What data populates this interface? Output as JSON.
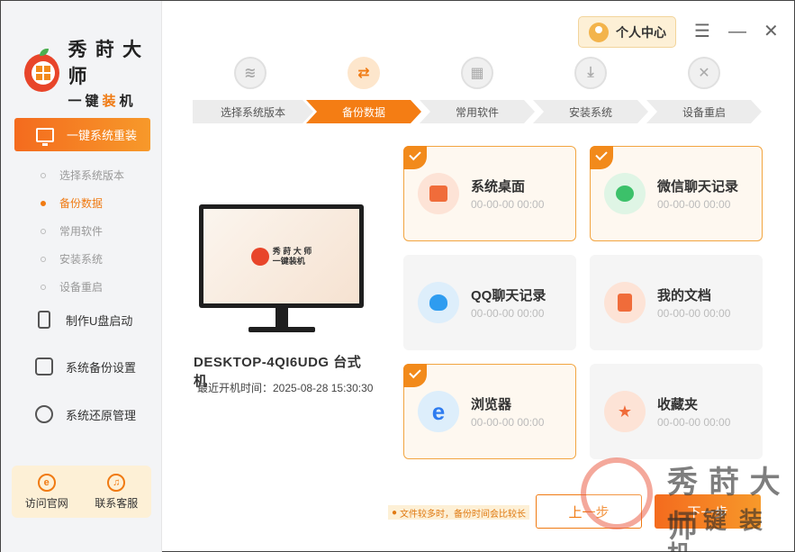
{
  "brand": {
    "title": "秀 莳 大 师",
    "subtitle_a": "一键",
    "subtitle_b": "装",
    "subtitle_c": "机"
  },
  "sidebar": {
    "active": "一键系统重装",
    "steps": [
      "选择系统版本",
      "备份数据",
      "常用软件",
      "安装系统",
      "设备重启"
    ],
    "items": [
      "制作U盘启动",
      "系统备份设置",
      "系统还原管理"
    ],
    "bottom": [
      "访问官网",
      "联系客服"
    ]
  },
  "header": {
    "user_center": "个人中心",
    "menu": "☰",
    "minimize": "—",
    "close": "✕"
  },
  "stepper": {
    "labels": [
      "选择系统版本",
      "备份数据",
      "常用软件",
      "安装系统",
      "设备重启"
    ],
    "active_index": 1
  },
  "device": {
    "name": "DESKTOP-4QI6UDG 台式机",
    "boot_time": "最近开机时间：2025-08-28 15:30:30"
  },
  "cards": [
    {
      "name": "系统桌面",
      "time": "00-00-00 00:00",
      "selected": true
    },
    {
      "name": "微信聊天记录",
      "time": "00-00-00 00:00",
      "selected": true
    },
    {
      "name": "QQ聊天记录",
      "time": "00-00-00 00:00",
      "selected": false
    },
    {
      "name": "我的文档",
      "time": "00-00-00 00:00",
      "selected": false
    },
    {
      "name": "浏览器",
      "time": "00-00-00 00:00",
      "selected": true
    },
    {
      "name": "收藏夹",
      "time": "00-00-00 00:00",
      "selected": false
    }
  ],
  "footer": {
    "tip": "文件较多时，备份时间会比较长",
    "prev": "上一步",
    "next": "下一步"
  },
  "watermark": {
    "line1": "秀 莳 大 师",
    "line2": "一键装机"
  },
  "colors": {
    "accent": "#f47d14",
    "selected_border": "#f2a541"
  }
}
